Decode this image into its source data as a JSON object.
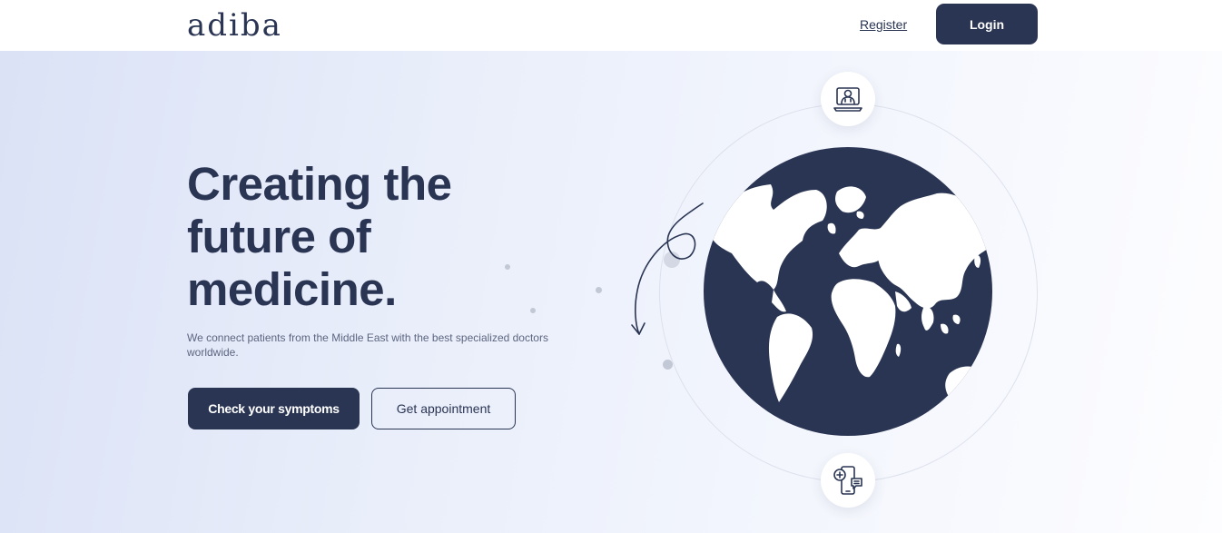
{
  "header": {
    "logo": "adiba",
    "register_label": "Register",
    "login_label": "Login"
  },
  "hero": {
    "headline_line1": "Creating the",
    "headline_line2": "future of",
    "headline_line3": "medicine.",
    "subtext": "We connect patients from the Middle East with the best specialized doctors worldwide.",
    "primary_cta": "Check your symptoms",
    "secondary_cta": "Get appointment"
  },
  "illustration": {
    "globe": "globe-icon",
    "top_icon": "doctor-laptop-icon",
    "bottom_icon": "mobile-chat-icon",
    "arrow": "hand-drawn-arrow-icon"
  },
  "colors": {
    "navy": "#2a3553",
    "background_start": "#dbe2f6",
    "background_end": "#fdfdff"
  }
}
